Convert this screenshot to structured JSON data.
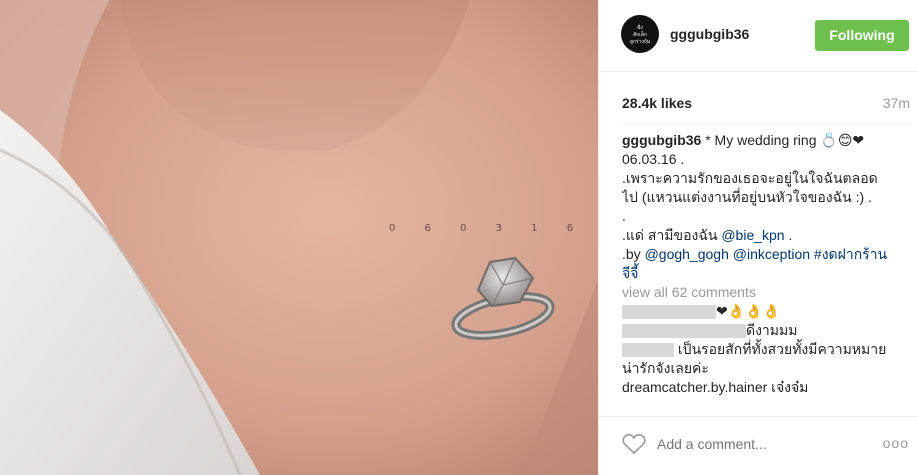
{
  "post": {
    "username": "gggubgib36",
    "follow_label": "Following",
    "likes": "28.4k likes",
    "time": "37m",
    "avatar_text": "ฝั่ง\nสักเล็ก\nลูกร่างกุ้ม",
    "tattoo_date": "0 6 0 3 1 6"
  },
  "caption": {
    "author": "gggubgib36",
    "line1": " * My wedding ring 💍😊❤",
    "line2": "06.03.16 .",
    "line3": ".เพราะความรักของเธอจะอยู่ในใจฉันตลอดไป (แหวนแต่งงานที่อยู่บนหัวใจของฉัน :) .",
    "dot": ".",
    "line5_prefix": ".แด่ สามีของฉัน ",
    "mention_bie": "@bie_kpn",
    "line5_suffix": " .",
    "line6_prefix": ".by ",
    "mention_gogh": "@gogh_gogh",
    "mention_inkception": "@inkception",
    "hashtag": "#งดฝากร้านจีจี้"
  },
  "comments": {
    "view_all": "view all 62 comments",
    "c1_text": "❤👌👌👌",
    "c2_text": "ดีงามมม",
    "c3_text": "เป็นรอยสักที่ทั้งสวยทั้งมีความหมาย น่ารักจังเลยค่ะ",
    "c4_text": "dreamcatcher.by.hainer เจ๋งจ๋ม"
  },
  "footer": {
    "add_comment_placeholder": "Add a comment...",
    "more_label": "ooo"
  },
  "colors": {
    "follow_green": "#70c050",
    "link_blue": "#003569",
    "muted_gray": "#999999"
  }
}
